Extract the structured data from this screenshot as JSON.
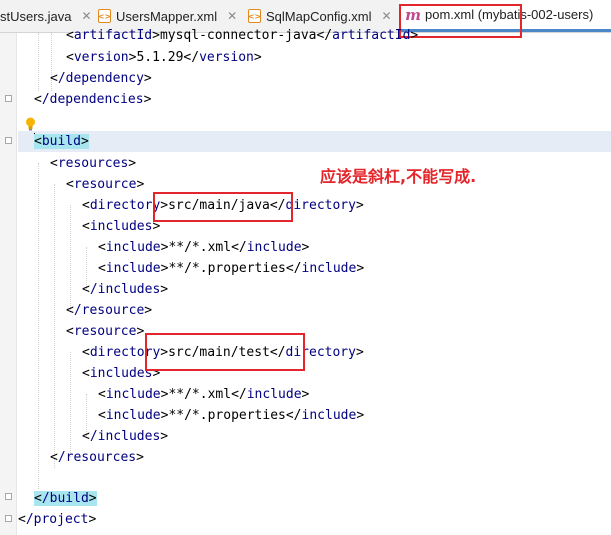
{
  "tabs": [
    {
      "label": "stUsers.java",
      "icon": "java-file-icon",
      "active": false
    },
    {
      "label": "UsersMapper.xml",
      "icon": "xml-file-icon",
      "active": false
    },
    {
      "label": "SqlMapConfig.xml",
      "icon": "xml-file-icon",
      "active": false
    },
    {
      "label": "pom.xml (mybatis-002-users)",
      "icon": "maven-icon",
      "active": true
    }
  ],
  "code": {
    "l1": {
      "tag": "artifactId",
      "text": "mysql-connector-java"
    },
    "l2": {
      "tag": "version",
      "text": "5.1.29"
    },
    "l3": {
      "tag": "/dependency"
    },
    "l4": {
      "tag": "/dependencies"
    },
    "l5": {
      "tag": "build"
    },
    "l6": {
      "tag": "resources"
    },
    "l7": {
      "tag": "resource"
    },
    "l8": {
      "tag": "directory",
      "text": "src/main/java"
    },
    "l9": {
      "tag": "includes"
    },
    "l10": {
      "tag": "include",
      "text": "**/*.xml"
    },
    "l11": {
      "tag": "include",
      "text": "**/*.properties"
    },
    "l12": {
      "tag": "/includes"
    },
    "l13": {
      "tag": "/resource"
    },
    "l14": {
      "tag": "resource"
    },
    "l15": {
      "tag": "directory",
      "text": "src/main/test"
    },
    "l16": {
      "tag": "includes"
    },
    "l17": {
      "tag": "include",
      "text": "**/*.xml"
    },
    "l18": {
      "tag": "include",
      "text": "**/*.properties"
    },
    "l19": {
      "tag": "/includes"
    },
    "l20": {
      "tag": "/resources"
    },
    "l21": {
      "tag": "/build"
    },
    "l22": {
      "tag": "/project"
    }
  },
  "annotation": "应该是斜杠,不能写成.",
  "colors": {
    "annotation": "#e3262b",
    "tag": "#000080",
    "highlight": "#a8e6ef",
    "active_tab_underline": "#4a88c7"
  }
}
